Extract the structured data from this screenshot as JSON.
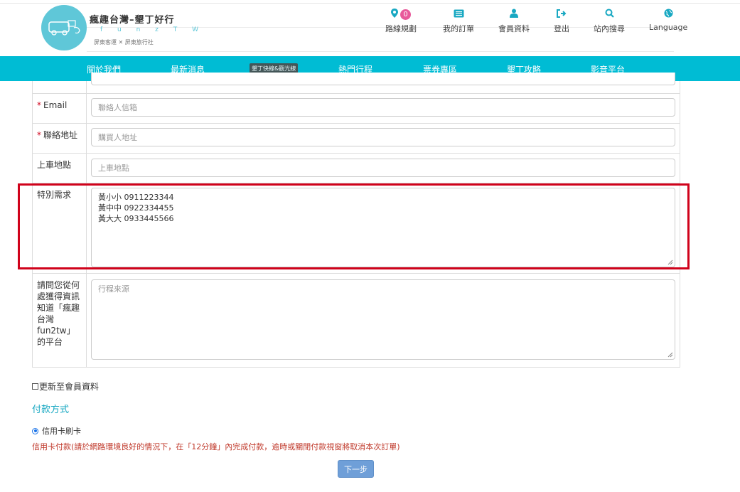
{
  "brand": {
    "title": "瘋趣台灣–墾丁好行",
    "subtitle": "f u n z T W",
    "tagline": "屏東客運 ✕ 屏東旅行社"
  },
  "topnav": [
    {
      "label": "路線規劃",
      "icon": "map-marker-icon",
      "badge": "0"
    },
    {
      "label": "我的訂單",
      "icon": "list-icon"
    },
    {
      "label": "會員資料",
      "icon": "user-icon"
    },
    {
      "label": "登出",
      "icon": "sign-out-icon"
    },
    {
      "label": "站內搜尋",
      "icon": "search-icon"
    },
    {
      "label": "Language",
      "icon": "globe-icon"
    }
  ],
  "mainnav": {
    "items": [
      "關於我們",
      "最新消息",
      "熱門行程",
      "票券專區",
      "墾丁攻略",
      "影音平台"
    ],
    "pill": "墾丁快線&觀光線"
  },
  "form": {
    "email": {
      "label": "Email",
      "placeholder": "聯絡人信箱"
    },
    "address": {
      "label": "聯絡地址",
      "placeholder": "購買人地址"
    },
    "pickup": {
      "label": "上車地點",
      "placeholder": "上車地點"
    },
    "special": {
      "label": "特別需求",
      "lines": [
        "黃小小 0911223344",
        "黃中中 0922334455",
        "黃大大 0933445566"
      ]
    },
    "source": {
      "label_lines": [
        "請問您從何",
        "處獲得資訊",
        "知道「瘋趣",
        "台灣",
        "fun2tw」",
        "的平台"
      ],
      "placeholder": "行程來源"
    },
    "required_mark": "*"
  },
  "update_member": "更新至會員資料",
  "payment": {
    "title": "付款方式",
    "option": "信用卡刷卡",
    "note": "信用卡付款(請於網路環境良好的情況下，在「12分鐘」內完成付款，逾時或關閉付款視窗將取消本次訂單)"
  },
  "next_button": "下一步",
  "colors": {
    "nav_bg": "#00bcd4",
    "accent": "#18a8c2",
    "badge": "#e85a9b",
    "highlight": "#d0021b",
    "button": "#6f9fd8"
  }
}
